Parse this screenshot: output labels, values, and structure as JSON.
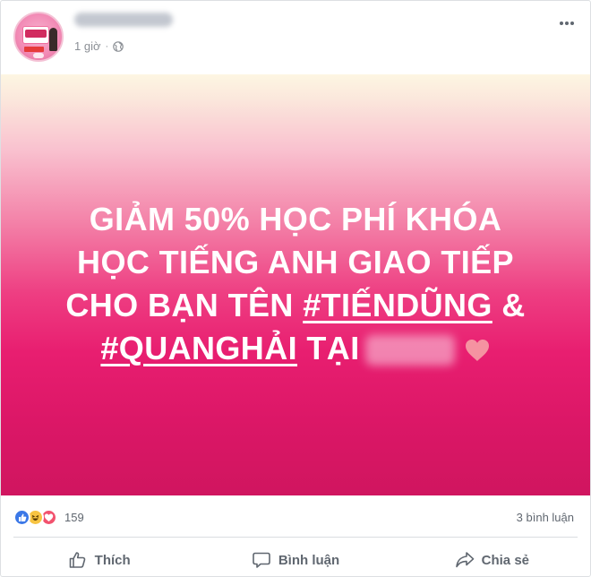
{
  "post": {
    "time": "1 giờ",
    "separator": "·",
    "headline": {
      "line1": "GIẢM 50% HỌC PHÍ KHÓA",
      "line2": "HỌC TIẾNG ANH GIAO TIẾP",
      "line3_prefix": "CHO BẠN TÊN ",
      "tag1": "#TIẾNDŨNG",
      "line3_suffix": " &",
      "tag2": "#QUANGHẢI",
      "line4_suffix": " TẠI"
    }
  },
  "reactions": {
    "count": "159",
    "comments": "3 bình luận"
  },
  "actions": {
    "like": "Thích",
    "comment": "Bình luận",
    "share": "Chia sẻ"
  },
  "colors": {
    "gradient_top": "#fdf6e2",
    "gradient_mid": "#ee3e82",
    "gradient_bottom": "#d0155f",
    "like_blue": "#3b78e7",
    "love_red": "#f2526e",
    "haha_yellow": "#f7c442"
  },
  "icons": [
    "globe-icon",
    "more-options-icon",
    "like-reaction-icon",
    "haha-reaction-icon",
    "love-reaction-icon",
    "heart-icon",
    "thumbs-up-icon",
    "comment-icon",
    "share-icon"
  ]
}
